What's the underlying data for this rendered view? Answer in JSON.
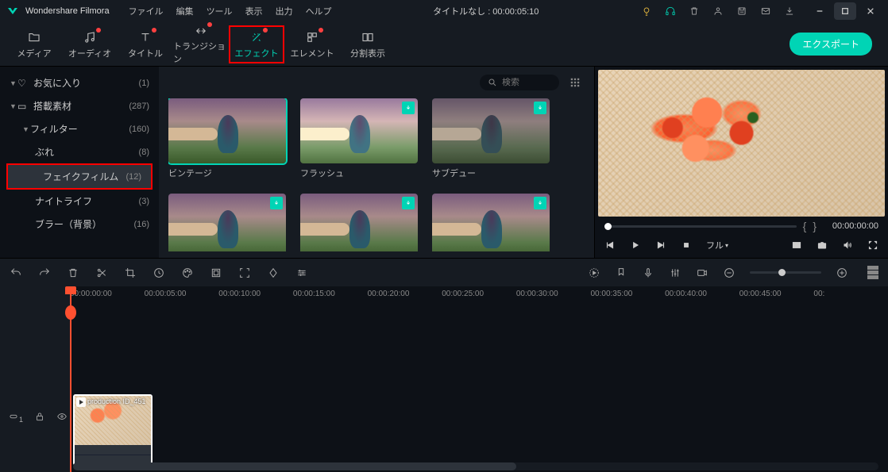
{
  "app": {
    "name": "Wondershare Filmora"
  },
  "menu": [
    "ファイル",
    "編集",
    "ツール",
    "表示",
    "出力",
    "ヘルプ"
  ],
  "titleCenter": "タイトルなし : 00:00:05:10",
  "tabs": [
    {
      "label": "メディア"
    },
    {
      "label": "オーディオ",
      "dot": true
    },
    {
      "label": "タイトル",
      "dot": true
    },
    {
      "label": "トランジション",
      "dot": true
    },
    {
      "label": "エフェクト",
      "dot": true,
      "active": true,
      "highlight": true
    },
    {
      "label": "エレメント",
      "dot": true
    },
    {
      "label": "分割表示"
    }
  ],
  "exportLabel": "エクスポート",
  "sidebar": [
    {
      "label": "お気に入り",
      "count": "(1)",
      "icon": "heart",
      "chev": "▼"
    },
    {
      "label": "搭載素材",
      "count": "(287)",
      "icon": "folder",
      "chev": "▼"
    },
    {
      "label": "フィルター",
      "count": "(160)",
      "chev": "▼",
      "indent": 1
    },
    {
      "label": "ぶれ",
      "count": "(8)",
      "indent": 2
    },
    {
      "label": "フェイクフィルム",
      "count": "(12)",
      "indent": 2,
      "selected": true,
      "highlight": true
    },
    {
      "label": "ナイトライフ",
      "count": "(3)",
      "indent": 2
    },
    {
      "label": "ブラー（背景）",
      "count": "(16)",
      "indent": 2
    }
  ],
  "search": {
    "placeholder": "検索"
  },
  "thumbs": [
    {
      "label": "ビンテージ",
      "selected": true
    },
    {
      "label": "フラッシュ",
      "dl": true,
      "variant": "flash"
    },
    {
      "label": "サブデュー",
      "dl": true,
      "variant": "subdue"
    },
    {
      "label": "",
      "dl": true
    },
    {
      "label": "",
      "dl": true
    },
    {
      "label": "",
      "dl": true
    }
  ],
  "preview": {
    "time": "00:00:00:00",
    "quality": "フル"
  },
  "ruler": [
    "00:00:00:00",
    "00:00:05:00",
    "00:00:10:00",
    "00:00:15:00",
    "00:00:20:00",
    "00:00:25:00",
    "00:00:30:00",
    "00:00:35:00",
    "00:00:40:00",
    "00:00:45:00",
    "00:"
  ],
  "clip": {
    "label": "production ID_451"
  },
  "trackBadge": "1"
}
